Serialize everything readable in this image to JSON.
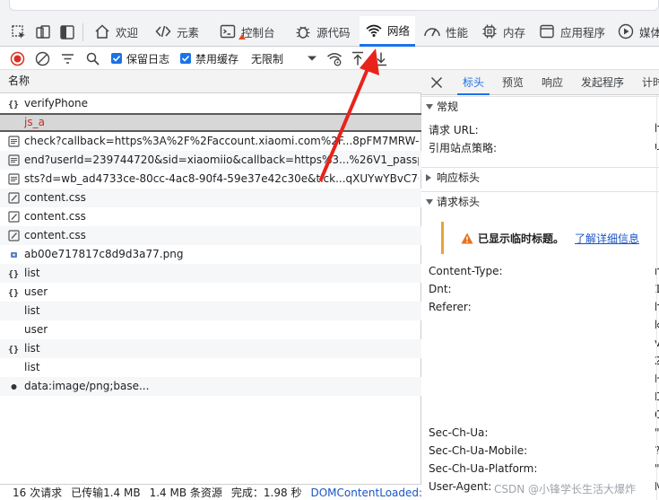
{
  "tabs": [
    {
      "label": "欢迎",
      "icon": "home-icon"
    },
    {
      "label": "元素",
      "icon": "code-icon"
    },
    {
      "label": "控制台",
      "icon": "console-icon"
    },
    {
      "label": "源代码",
      "icon": "bug-icon"
    },
    {
      "label": "网络",
      "icon": "wifi-icon",
      "active": true
    },
    {
      "label": "性能",
      "icon": "gauge-icon"
    },
    {
      "label": "内存",
      "icon": "chip-icon"
    },
    {
      "label": "应用程序",
      "icon": "app-icon"
    },
    {
      "label": "媒体",
      "icon": "play-icon"
    }
  ],
  "toolbar": {
    "preserve_log_label": "保留日志",
    "disable_cache_label": "禁用缓存",
    "throttle_label": "无限制"
  },
  "request_list": {
    "header": "名称",
    "rows": [
      {
        "name": "verifyPhone",
        "icon": "braces-icon"
      },
      {
        "name": "js_a",
        "icon": "",
        "selected": true
      },
      {
        "name": "check?callback=https%3A%2F%2Faccount.xiaomi.com%2F...8pFM7MRW-8...",
        "icon": "doc-icon"
      },
      {
        "name": "end?userId=239744720&sid=xiaomiio&callback=https%3...%26V1_passpo...",
        "icon": "doc-icon"
      },
      {
        "name": "sts?d=wb_ad4733ce-80cc-4ac8-90f4-59e37e42c30e&tick...qXUYwYBvC70...",
        "icon": "doc-icon"
      },
      {
        "name": "content.css",
        "icon": "css-icon"
      },
      {
        "name": "content.css",
        "icon": "css-icon"
      },
      {
        "name": "content.css",
        "icon": "css-icon"
      },
      {
        "name": "ab00e717817c8d9d3a77.png",
        "icon": "image-icon"
      },
      {
        "name": "list",
        "icon": "braces-icon"
      },
      {
        "name": "user",
        "icon": "braces-icon"
      },
      {
        "name": "list",
        "icon": ""
      },
      {
        "name": "user",
        "icon": ""
      },
      {
        "name": "list",
        "icon": "braces-icon"
      },
      {
        "name": "list",
        "icon": ""
      },
      {
        "name": "data:image/png;base...",
        "icon": "dot-icon"
      }
    ]
  },
  "status": {
    "requests": "16 次请求",
    "transferred": "已传输1.4 MB",
    "resources": "1.4 MB 条资源",
    "finish": "完成：1.98 秒",
    "dcl": "DOMContentLoaded:"
  },
  "detail": {
    "tabs": [
      "标头",
      "预览",
      "响应",
      "发起程序",
      "计时"
    ],
    "active_tab": "标头",
    "general": {
      "title": "常规",
      "request_url_label": "请求 URL:",
      "referrer_policy_label": "引用站点策略:",
      "request_url_value": "h",
      "referrer_policy_value": "u"
    },
    "response_headers_title": "响应标头",
    "request_headers_title": "请求标头",
    "warning_text": "已显示临时标题。",
    "warning_link": "了解详细信息",
    "headers": [
      {
        "key": "Content-Type:",
        "value": "n"
      },
      {
        "key": "Dnt:",
        "value": "1"
      },
      {
        "key": "Referer:",
        "value": "h"
      },
      {
        "key": "",
        "value": "k"
      },
      {
        "key": "",
        "value": "v"
      },
      {
        "key": "",
        "value": "2"
      },
      {
        "key": "",
        "value": "H"
      },
      {
        "key": "",
        "value": "D"
      },
      {
        "key": "",
        "value": "C"
      },
      {
        "key": "Sec-Ch-Ua:",
        "value": "\""
      },
      {
        "key": "Sec-Ch-Ua-Mobile:",
        "value": "?"
      },
      {
        "key": "Sec-Ch-Ua-Platform:",
        "value": "\""
      },
      {
        "key": "User-Agent:",
        "value": "M"
      }
    ]
  },
  "watermark": "CSDN @小锋学长生活大爆炸",
  "colors": {
    "accent": "#1a73e8",
    "annotation_arrow": "#e8231b",
    "warning": "#e8a33b"
  }
}
